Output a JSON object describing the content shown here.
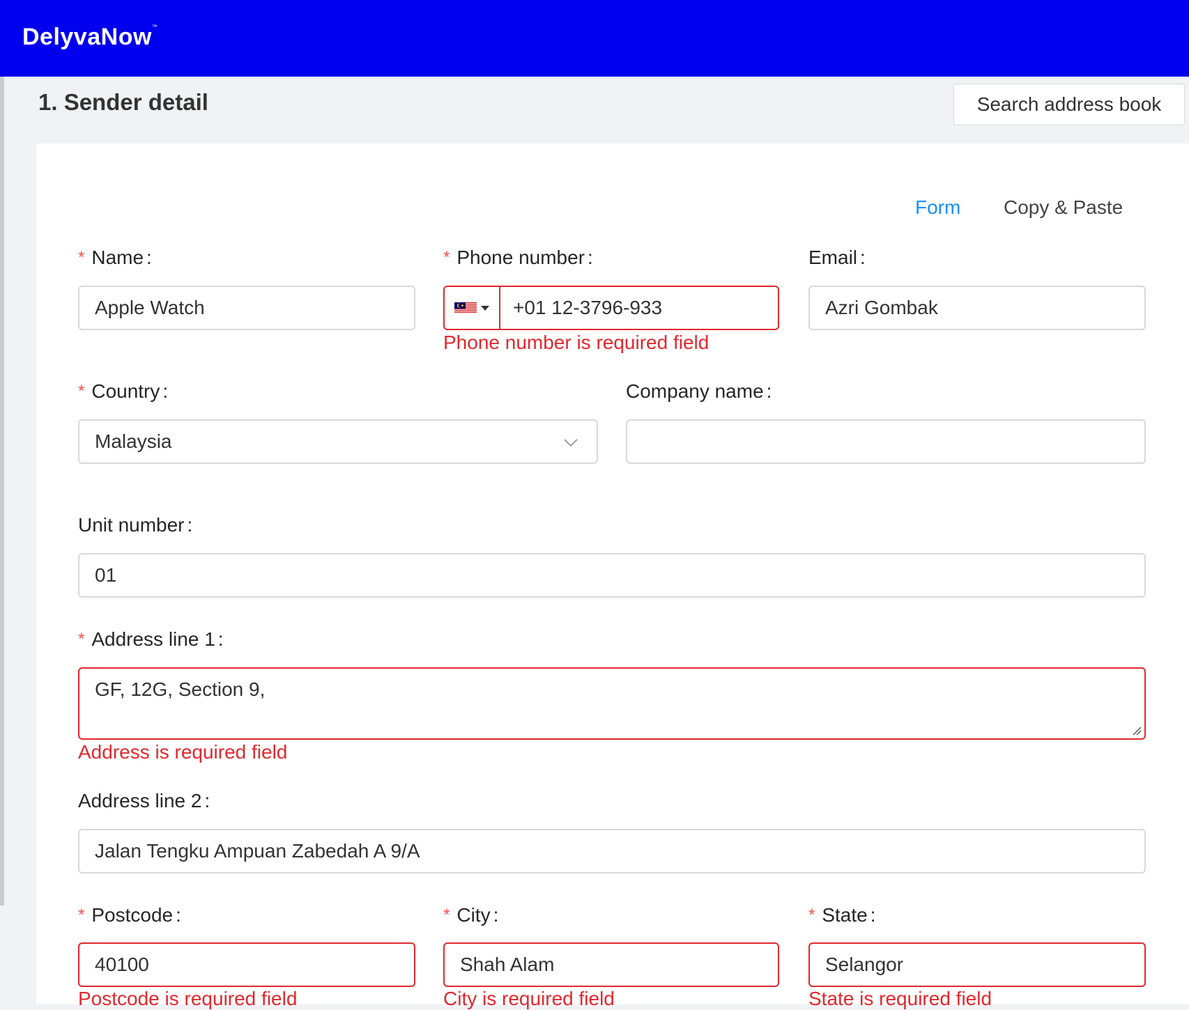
{
  "header": {
    "brand": "DelyvaNow",
    "brand_mark": "™"
  },
  "section": {
    "title": "1. Sender detail",
    "address_book_button": "Search address book"
  },
  "tabs": {
    "form": "Form",
    "copy_paste": "Copy & Paste"
  },
  "colors": {
    "brand": "#0000ee",
    "error": "#e0282e",
    "accent": "#1890ff"
  },
  "fields": {
    "name": {
      "label": "Name",
      "value": "Apple Watch"
    },
    "phone": {
      "label": "Phone number",
      "value": "+01 12-3796-933",
      "error": "Phone number is required field",
      "flag_icon": "malaysia-flag-icon"
    },
    "email": {
      "label": "Email",
      "value": "Azri Gombak"
    },
    "country": {
      "label": "Country",
      "value": "Malaysia"
    },
    "company": {
      "label": "Company name",
      "value": ""
    },
    "unit": {
      "label": "Unit number",
      "value": "01"
    },
    "address1": {
      "label": "Address line 1",
      "value": "GF, 12G,  Section 9,",
      "error": "Address is required field"
    },
    "address2": {
      "label": "Address line 2",
      "value": "Jalan Tengku Ampuan Zabedah A 9/A"
    },
    "postcode": {
      "label": "Postcode",
      "value": "40100",
      "error": "Postcode is required field"
    },
    "city": {
      "label": "City",
      "value": "Shah Alam",
      "error": "City is required field"
    },
    "state": {
      "label": "State",
      "value": "Selangor",
      "error": "State is required field"
    }
  },
  "form": {
    "colon": ":",
    "required_mark": "*"
  }
}
